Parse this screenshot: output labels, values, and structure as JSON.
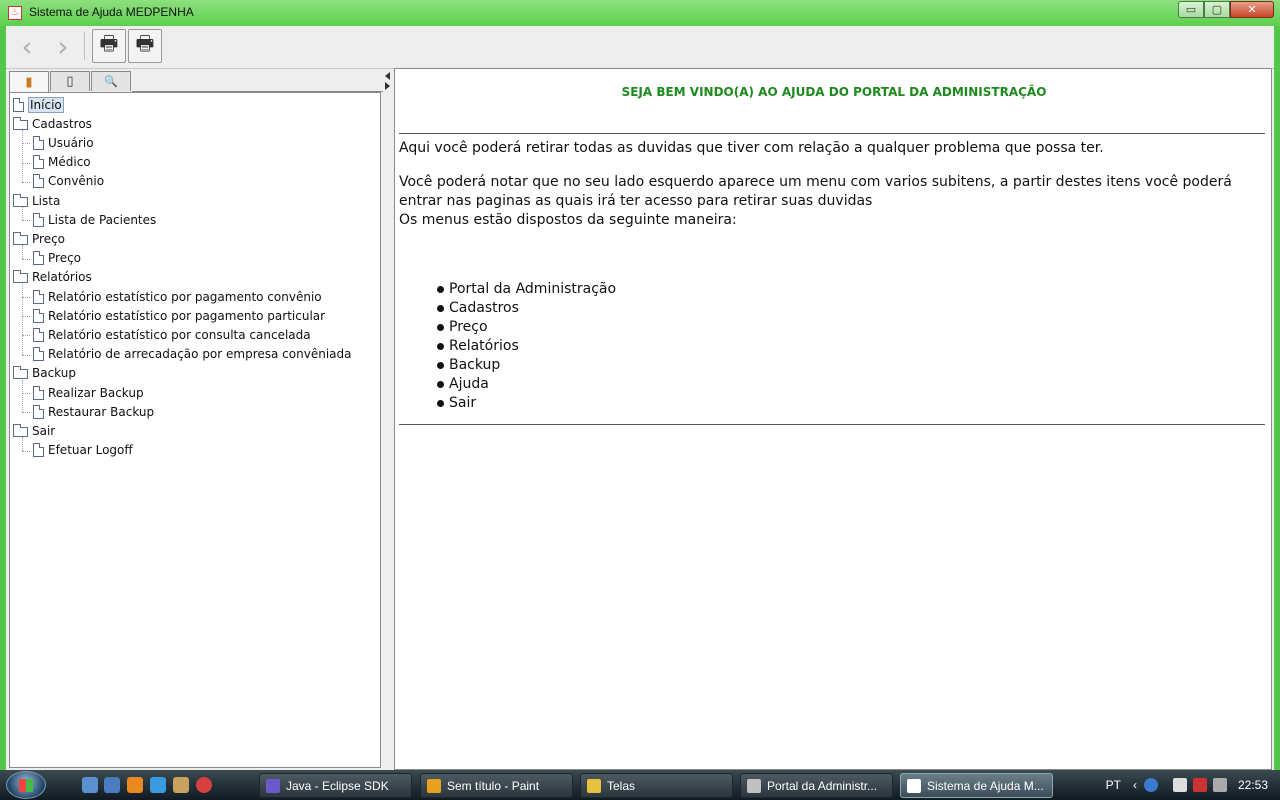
{
  "window": {
    "title": "Sistema de Ajuda MEDPENHA",
    "title_icon": "java-icon",
    "controls": {
      "minimize": "▭",
      "maximize": "▢",
      "close": "✕"
    }
  },
  "toolbar": {
    "back_icon": "‹",
    "forward_icon": "›",
    "print_icon": "🖶",
    "page_setup_icon": "🖶"
  },
  "navigator": {
    "tabs": [
      {
        "name": "contents",
        "icon": "▮"
      },
      {
        "name": "index",
        "icon": "▯"
      },
      {
        "name": "search",
        "icon": "🔍"
      }
    ],
    "tree": [
      {
        "label": "Início",
        "type": "doc",
        "level": 0,
        "selected": true
      },
      {
        "label": "Cadastros",
        "type": "folder",
        "level": 0
      },
      {
        "label": "Usuário",
        "type": "doc",
        "level": 1
      },
      {
        "label": "Médico",
        "type": "doc",
        "level": 1
      },
      {
        "label": "Convênio",
        "type": "doc",
        "level": 1
      },
      {
        "label": "Lista",
        "type": "folder",
        "level": 0
      },
      {
        "label": "Lista de Pacientes",
        "type": "doc",
        "level": 1
      },
      {
        "label": "Preço",
        "type": "folder",
        "level": 0
      },
      {
        "label": "Preço",
        "type": "doc",
        "level": 1
      },
      {
        "label": "Relatórios",
        "type": "folder",
        "level": 0
      },
      {
        "label": "Relatório estatístico por pagamento convênio",
        "type": "doc",
        "level": 1
      },
      {
        "label": "Relatório estatístico por pagamento particular",
        "type": "doc",
        "level": 1
      },
      {
        "label": "Relatório estatístico por consulta cancelada",
        "type": "doc",
        "level": 1
      },
      {
        "label": "Relatório de arrecadação por empresa convêniada",
        "type": "doc",
        "level": 1
      },
      {
        "label": "Backup",
        "type": "folder",
        "level": 0
      },
      {
        "label": "Realizar Backup",
        "type": "doc",
        "level": 1
      },
      {
        "label": "Restaurar Backup",
        "type": "doc",
        "level": 1
      },
      {
        "label": "Sair",
        "type": "folder",
        "level": 0
      },
      {
        "label": "Efetuar Logoff",
        "type": "doc",
        "level": 1
      }
    ]
  },
  "content": {
    "heading": "SEJA BEM VINDO(A) AO AJUDA DO PORTAL DA ADMINISTRAÇÃO",
    "para1": "Aqui você poderá retirar todas as duvidas que tiver com relação a qualquer problema que possa ter.",
    "para2_line1": "Você poderá notar que no seu lado esquerdo aparece um menu com varios subitens, a partir destes itens você poderá",
    "para2_line2": "entrar nas paginas as quais irá ter acesso para retirar suas duvidas",
    "para3": "Os menus estão dispostos da seguinte maneira:",
    "menu_items": [
      "Portal da Administração",
      "Cadastros",
      "Preço",
      "Relatórios",
      "Backup",
      "Ajuda",
      "Sair"
    ],
    "heading_color": "#1d8a1d"
  },
  "taskbar": {
    "tasks": [
      {
        "label": "Java - Eclipse SDK",
        "icon_color": "#6a5acd",
        "active": false
      },
      {
        "label": "Sem título - Paint",
        "icon_color": "#e8a020",
        "active": false
      },
      {
        "label": "Telas",
        "icon_color": "#e8c040",
        "active": false
      },
      {
        "label": "Portal da Administr...",
        "icon_color": "#c0c0c0",
        "active": false
      },
      {
        "label": "Sistema de Ajuda M...",
        "icon_color": "#ffffff",
        "active": true
      }
    ],
    "language": "PT",
    "clock": "22:53"
  }
}
